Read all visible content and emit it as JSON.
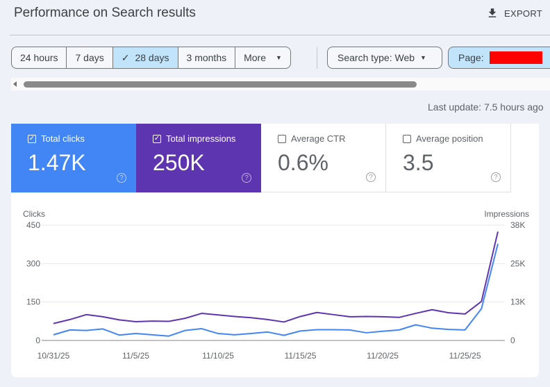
{
  "header": {
    "title": "Performance on Search results",
    "export_label": "EXPORT"
  },
  "filters": {
    "date_ranges": [
      {
        "label": "24 hours",
        "selected": false
      },
      {
        "label": "7 days",
        "selected": false
      },
      {
        "label": "28 days",
        "selected": true
      },
      {
        "label": "3 months",
        "selected": false
      },
      {
        "label": "More",
        "selected": false
      }
    ],
    "search_type": "Search type: Web",
    "page_label": "Page:"
  },
  "last_update": "Last update: 7.5 hours ago",
  "metrics": [
    {
      "label": "Total clicks",
      "value": "1.47K",
      "checked": true,
      "color": "#4285f4"
    },
    {
      "label": "Total impressions",
      "value": "250K",
      "checked": true,
      "color": "#5e35b1"
    },
    {
      "label": "Average CTR",
      "value": "0.6%",
      "checked": false
    },
    {
      "label": "Average position",
      "value": "3.5",
      "checked": false
    }
  ],
  "chart_data": {
    "type": "line",
    "left_axis": {
      "label": "Clicks",
      "ticks": [
        "0",
        "150",
        "300",
        "450"
      ],
      "range": [
        0,
        450
      ]
    },
    "right_axis": {
      "label": "Impressions",
      "ticks": [
        "0",
        "13K",
        "25K",
        "38K"
      ],
      "range": [
        0,
        37500
      ]
    },
    "x_tick_labels": [
      "10/31/25",
      "11/5/25",
      "11/10/25",
      "11/15/25",
      "11/20/25",
      "11/25/25"
    ],
    "x": [
      "10/31/25",
      "11/1/25",
      "11/2/25",
      "11/3/25",
      "11/4/25",
      "11/5/25",
      "11/6/25",
      "11/7/25",
      "11/8/25",
      "11/9/25",
      "11/10/25",
      "11/11/25",
      "11/12/25",
      "11/13/25",
      "11/14/25",
      "11/15/25",
      "11/16/25",
      "11/17/25",
      "11/18/25",
      "11/19/25",
      "11/20/25",
      "11/21/25",
      "11/22/25",
      "11/23/25",
      "11/24/25",
      "11/25/25",
      "11/26/25",
      "11/27/25"
    ],
    "series": [
      {
        "name": "Clicks",
        "axis": "left",
        "color": "#4285f4",
        "values": [
          22,
          41,
          39,
          45,
          21,
          27,
          22,
          17,
          39,
          46,
          27,
          22,
          27,
          33,
          20,
          37,
          42,
          42,
          41,
          30,
          36,
          41,
          61,
          48,
          43,
          41,
          124,
          377
        ]
      },
      {
        "name": "Impressions",
        "axis": "right",
        "color": "#5e35b1",
        "values": [
          5500,
          6800,
          8400,
          7700,
          6700,
          6100,
          6300,
          6200,
          7200,
          8800,
          8300,
          7800,
          7400,
          6800,
          6000,
          7800,
          9100,
          8400,
          7700,
          7800,
          7700,
          7500,
          8800,
          10000,
          9000,
          8600,
          12700,
          35400
        ]
      }
    ],
    "grid": true
  }
}
